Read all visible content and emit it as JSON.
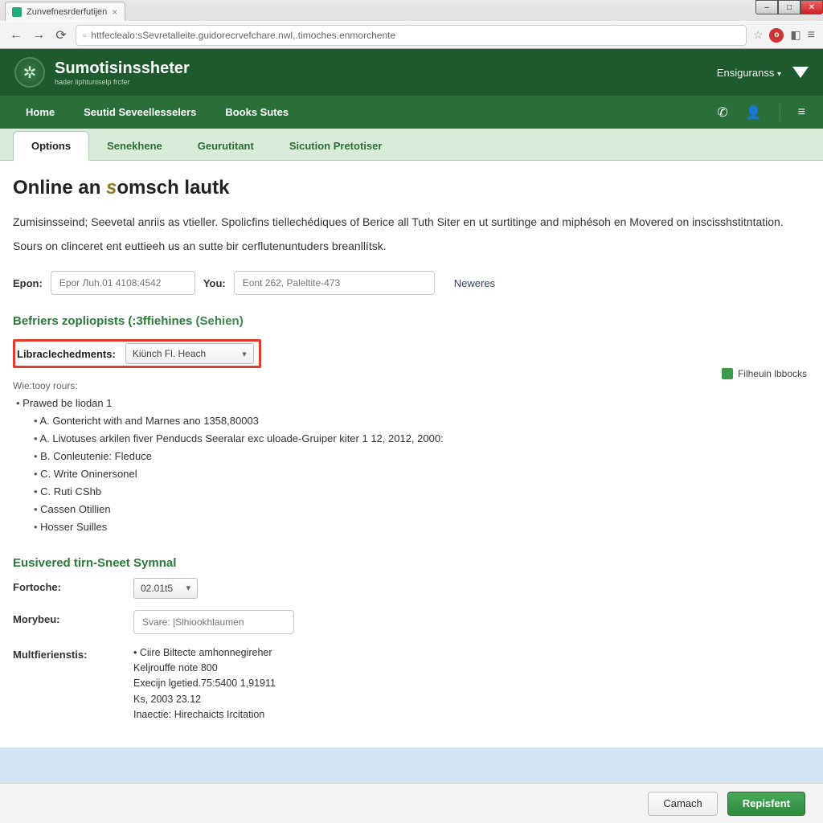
{
  "browser": {
    "tab_title": "Zunvefnesrderfutijen",
    "url": "httfeclealo:sSevretalleite.guidorecrvefchare.nwl,.timoches.enmorchente",
    "ext_badge": "o"
  },
  "window": {
    "min": "–",
    "max": "□",
    "close": "✕"
  },
  "header": {
    "brand_title": "Sumotisinssheter",
    "brand_sub": "hader liphtuniselp frcfer",
    "right_label": "Ensiguranss",
    "logo_glyph": "✲"
  },
  "nav": {
    "items": [
      "Home",
      "Seutid Seveellesselers",
      "Books Sutes"
    ]
  },
  "subtabs": {
    "items": [
      "Options",
      "Senekhene",
      "Geurutitant",
      "Sicution Pretotiser"
    ],
    "active_index": 0
  },
  "page": {
    "title_pre": "Online an ",
    "title_accent": "s",
    "title_post": "omsch lautk",
    "intro1": "Zumisinsseind; Seevetal anriis as vtieller. Spolicfins tiellechédiques of Berice all Tuth Siter en ut surtitinge and miphésoh en Movered on inscisshstitntation.",
    "intro2": "Sours on clinceret ent euttieeh us an sutte bir cerflutenuntuders breanllítsk."
  },
  "inputs": {
    "epon_label": "Epon:",
    "epon_placeholder": "Epor Лuh.01 4108:4542",
    "you_label": "You:",
    "you_placeholder": "Eont 262, Paleltite-473",
    "neweres": "Neweres"
  },
  "section1": {
    "title": "Befriers zopliopists (:3ffiehines",
    "paren": "(Sehien)",
    "flag_label": "Filheuin lbbocks",
    "lib_label": "Libraclechedments:",
    "lib_select": "Kiünch Fl. Heach",
    "wie": "Wie:tooy rours:",
    "item1": "Prawed be liodan 1",
    "sub_a1": "A. Gontericht with and Marnes ano 1358,80003",
    "sub_a2": "A. Livotuses arkilen fiver Penducds Seeralar exc uloade-Gruiper kiter 1 12, 2012, 2000:",
    "sub_b": "B. Conleutenie: Fleduce",
    "sub_c1": "C. Write Oninersonel",
    "sub_c2": "C. Ruti CShb",
    "sub_cassen": "Cassen Otillien",
    "sub_hosser": "Hosser Suilles"
  },
  "section2": {
    "title": "Eusivered tirn-Sneet Symnal",
    "fortoche_label": "Fortoche:",
    "fortoche_value": "02.01t5",
    "morybeu_label": "Morybeu:",
    "morybeu_placeholder": "Svare: |Slhiookhlaumen",
    "multf_label": "Multfierienstis:",
    "multf_lines": [
      "• Ciire Biltecte amhonnegireher",
      "Keljrouffe note 800",
      "Execijn lgetied.75:5400 1,91911",
      "Ks, 2003 23.12",
      "Inaectie: Hirechaicts Ircitation"
    ]
  },
  "footer": {
    "cancel": "Camach",
    "submit": "Repisfent"
  }
}
